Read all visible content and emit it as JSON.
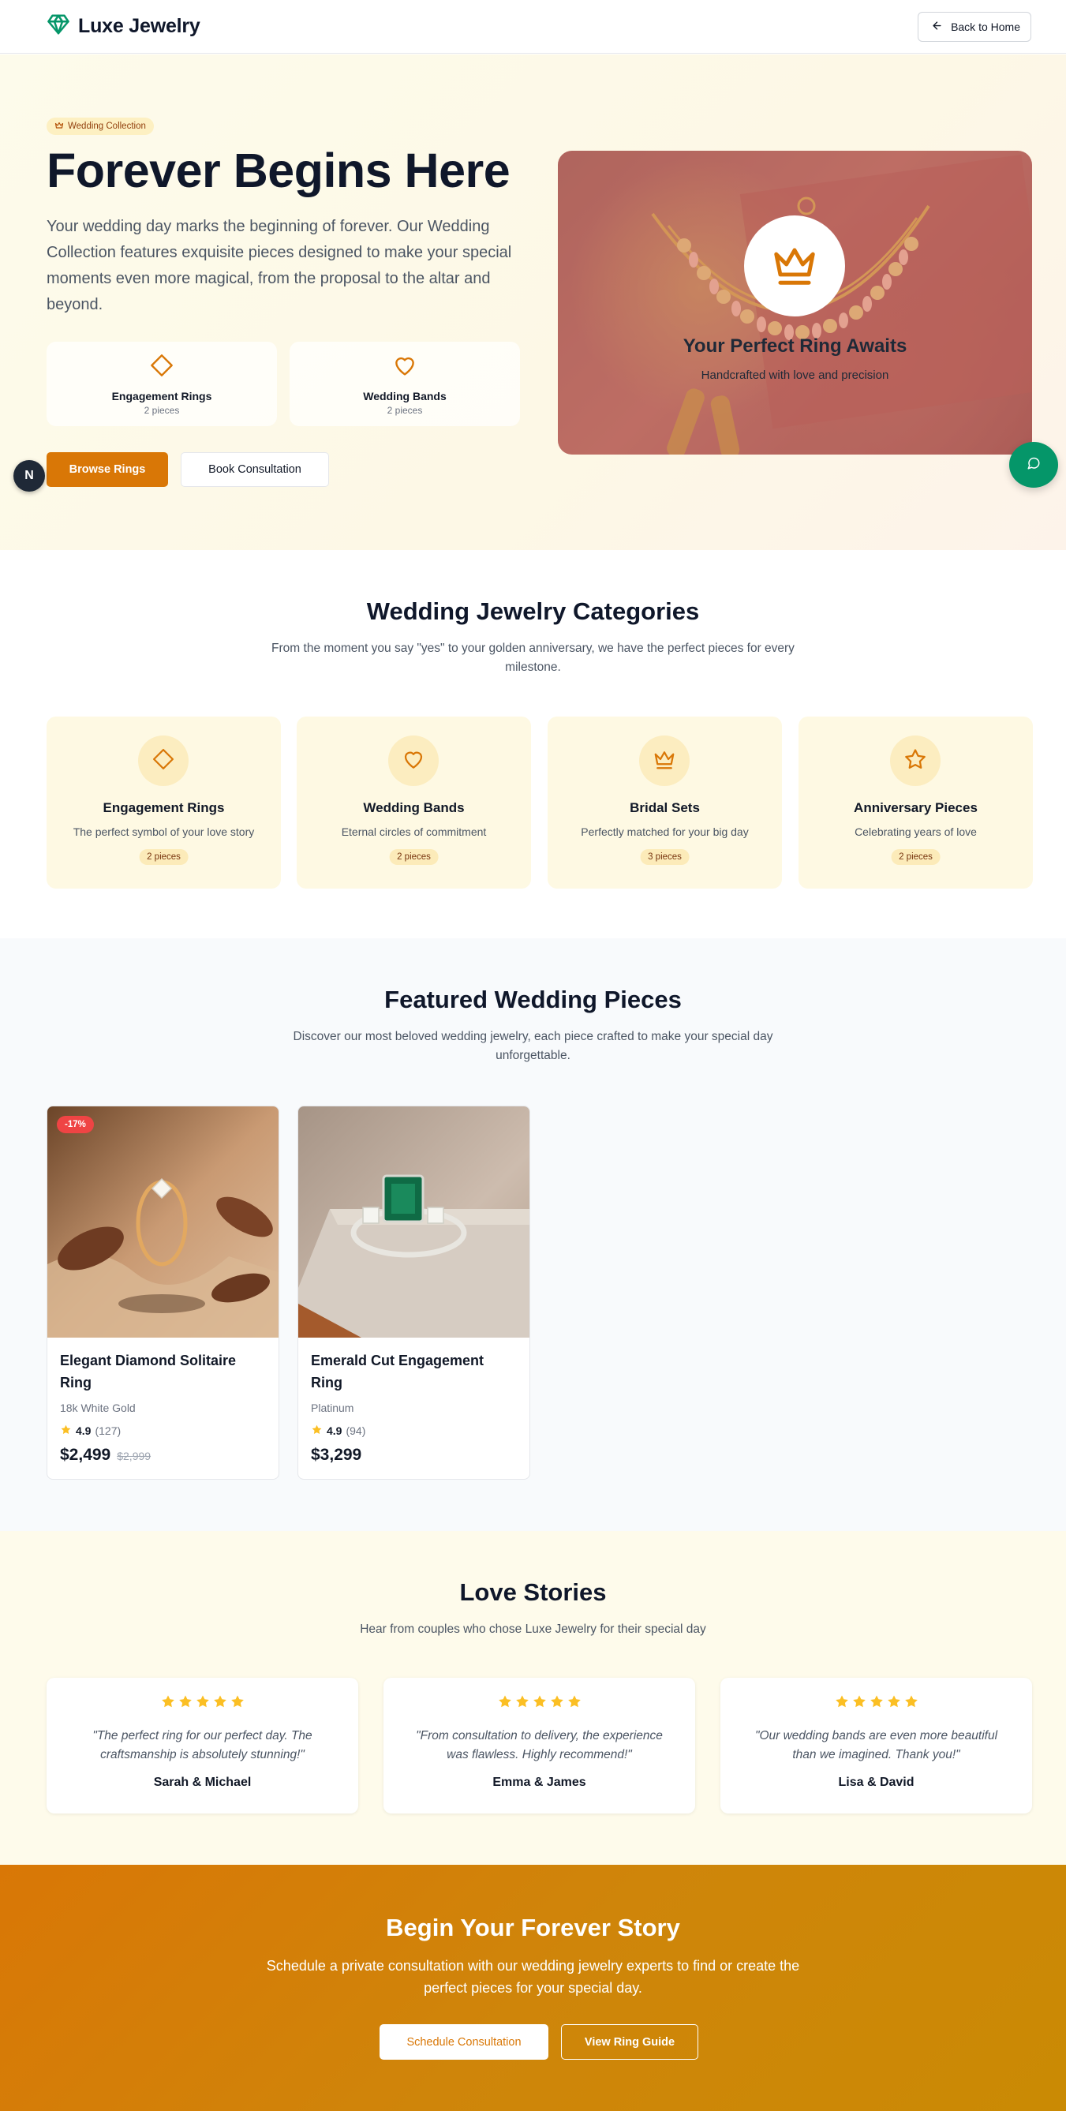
{
  "header": {
    "brand_name": "Luxe Jewelry",
    "back_label": "Back to Home"
  },
  "hero": {
    "badge": "Wedding Collection",
    "title": "Forever Begins Here",
    "description": "Your wedding day marks the beginning of forever. Our Wedding Collection features exquisite pieces designed to make your special moments even more magical, from the proposal to the altar and beyond.",
    "mini_cards": [
      {
        "title": "Engagement Rings",
        "count": "2 pieces",
        "icon": "diamond-icon"
      },
      {
        "title": "Wedding Bands",
        "count": "2 pieces",
        "icon": "heart-icon"
      }
    ],
    "primary_button": "Browse Rings",
    "secondary_button": "Book Consultation",
    "image_title": "Your Perfect Ring Awaits",
    "image_subtitle": "Handcrafted with love and precision"
  },
  "floating": {
    "n_badge": "N"
  },
  "categories": {
    "title": "Wedding Jewelry Categories",
    "subtitle": "From the moment you say \"yes\" to your golden anniversary, we have the perfect pieces for every milestone.",
    "items": [
      {
        "title": "Engagement Rings",
        "desc": "The perfect symbol of your love story",
        "count": "2 pieces",
        "icon": "diamond-icon"
      },
      {
        "title": "Wedding Bands",
        "desc": "Eternal circles of commitment",
        "count": "2 pieces",
        "icon": "heart-icon"
      },
      {
        "title": "Bridal Sets",
        "desc": "Perfectly matched for your big day",
        "count": "3 pieces",
        "icon": "crown-icon"
      },
      {
        "title": "Anniversary Pieces",
        "desc": "Celebrating years of love",
        "count": "2 pieces",
        "icon": "star-icon"
      }
    ]
  },
  "featured": {
    "title": "Featured Wedding Pieces",
    "subtitle": "Discover our most beloved wedding jewelry, each piece crafted to make your special day unforgettable.",
    "products": [
      {
        "name": "Elegant Diamond Solitaire Ring",
        "material": "18k White Gold",
        "rating": "4.9",
        "reviews": "(127)",
        "price": "$2,499",
        "old_price": "$2,999",
        "discount": "-17%"
      },
      {
        "name": "Emerald Cut Engagement Ring",
        "material": "Platinum",
        "rating": "4.9",
        "reviews": "(94)",
        "price": "$3,299",
        "old_price": "",
        "discount": ""
      }
    ]
  },
  "stories": {
    "title": "Love Stories",
    "subtitle": "Hear from couples who chose Luxe Jewelry for their special day",
    "items": [
      {
        "quote": "\"The perfect ring for our perfect day. The craftsmanship is absolutely stunning!\"",
        "author": "Sarah & Michael",
        "stars": 5
      },
      {
        "quote": "\"From consultation to delivery, the experience was flawless. Highly recommend!\"",
        "author": "Emma & James",
        "stars": 5
      },
      {
        "quote": "\"Our wedding bands are even more beautiful than we imagined. Thank you!\"",
        "author": "Lisa & David",
        "stars": 5
      }
    ]
  },
  "cta": {
    "title": "Begin Your Forever Story",
    "subtitle": "Schedule a private consultation with our wedding jewelry experts to find or create the perfect pieces for your special day.",
    "primary_button": "Schedule Consultation",
    "secondary_button": "View Ring Guide"
  },
  "colors": {
    "accent": "#d97706",
    "brand_green": "#059669",
    "star": "#fbbf24",
    "discount": "#ef4444"
  }
}
